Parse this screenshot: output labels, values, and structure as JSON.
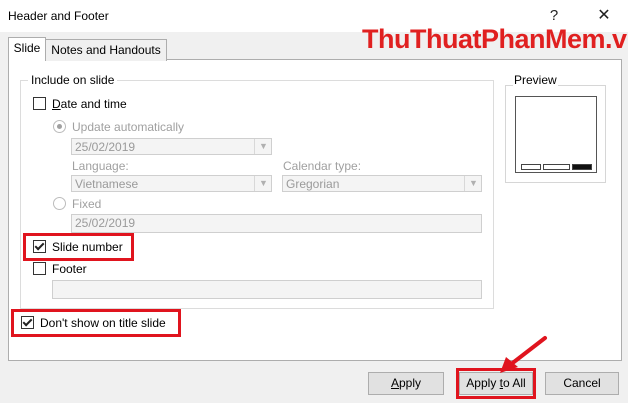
{
  "window": {
    "title": "Header and Footer",
    "help_glyph": "?",
    "close_glyph": "✕"
  },
  "watermark": {
    "part1": "ThuThuat",
    "part2": "PhanMem",
    "part3": ".vn"
  },
  "tabs": [
    {
      "label": "Slide",
      "active": true
    },
    {
      "label": "Notes and Handouts",
      "active": false
    }
  ],
  "include": {
    "legend": "Include on slide",
    "date_time": {
      "label": "Date and time",
      "checked": false
    },
    "update_auto": {
      "label": "Update automatically",
      "selected": true
    },
    "date_value": "25/02/2019",
    "language": {
      "label": "Language:",
      "value": "Vietnamese"
    },
    "calendar": {
      "label": "Calendar type:",
      "value": "Gregorian"
    },
    "fixed": {
      "label": "Fixed",
      "value": "25/02/2019"
    },
    "slide_number": {
      "label": "Slide number",
      "checked": true
    },
    "footer": {
      "label": "Footer",
      "checked": false,
      "value": ""
    }
  },
  "dont_show": {
    "label": "Don't show on title slide",
    "checked": true
  },
  "preview": {
    "label": "Preview"
  },
  "buttons": {
    "apply": "Apply",
    "apply_all": "Apply to All",
    "cancel": "Cancel"
  },
  "colors": {
    "highlight": "#e0141e",
    "watermark": "#e02020"
  }
}
